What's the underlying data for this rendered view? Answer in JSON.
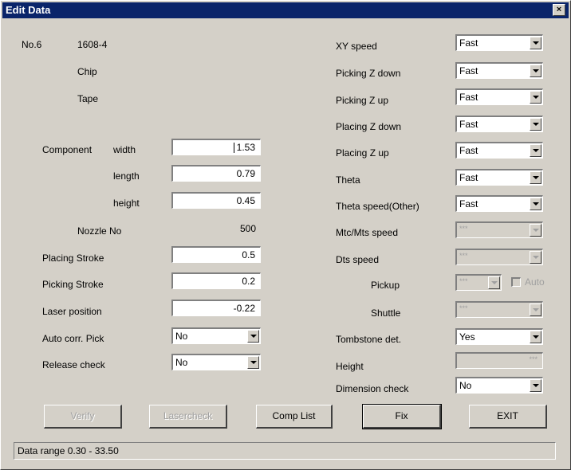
{
  "window": {
    "title": "Edit Data",
    "close_glyph": "×"
  },
  "header": {
    "no": "No.6",
    "size": "1608-4",
    "type": "Chip",
    "feed": "Tape"
  },
  "component": {
    "label": "Component",
    "width_label": "width",
    "width_value": "1.53",
    "length_label": "length",
    "length_value": "0.79",
    "height_label": "height",
    "height_value": "0.45",
    "nozzle_label": "Nozzle No",
    "nozzle_value": "500"
  },
  "left_fields": {
    "placing_stroke_label": "Placing Stroke",
    "placing_stroke_value": "0.5",
    "picking_stroke_label": "Picking Stroke",
    "picking_stroke_value": "0.2",
    "laser_position_label": "Laser position",
    "laser_position_value": "-0.22",
    "auto_corr_label": "Auto corr. Pick",
    "auto_corr_value": "No",
    "release_check_label": "Release check",
    "release_check_value": "No"
  },
  "right_fields": {
    "xy_speed_label": "XY speed",
    "xy_speed_value": "Fast",
    "picking_z_down_label": "Picking Z down",
    "picking_z_down_value": "Fast",
    "picking_z_up_label": "Picking Z up",
    "picking_z_up_value": "Fast",
    "placing_z_down_label": "Placing Z down",
    "placing_z_down_value": "Fast",
    "placing_z_up_label": "Placing Z up",
    "placing_z_up_value": "Fast",
    "theta_label": "Theta",
    "theta_value": "Fast",
    "theta_speed_other_label": "Theta speed(Other)",
    "theta_speed_other_value": "Fast",
    "mtc_mts_label": "Mtc/Mts speed",
    "mtc_mts_value": "***",
    "dts_label": "Dts speed",
    "dts_value": "***",
    "pickup_label": "Pickup",
    "pickup_value": "***",
    "auto_label": "Auto",
    "shuttle_label": "Shuttle",
    "shuttle_value": "***",
    "tombstone_label": "Tombstone det.",
    "tombstone_value": "Yes",
    "height_label": "Height",
    "height_value": "***",
    "dimension_check_label": "Dimension check",
    "dimension_check_value": "No"
  },
  "buttons": {
    "verify": "Verify",
    "lasercheck": "Lasercheck",
    "comp_list": "Comp List",
    "fix": "Fix",
    "exit": "EXIT"
  },
  "status": {
    "text": "Data range 0.30 - 33.50"
  }
}
